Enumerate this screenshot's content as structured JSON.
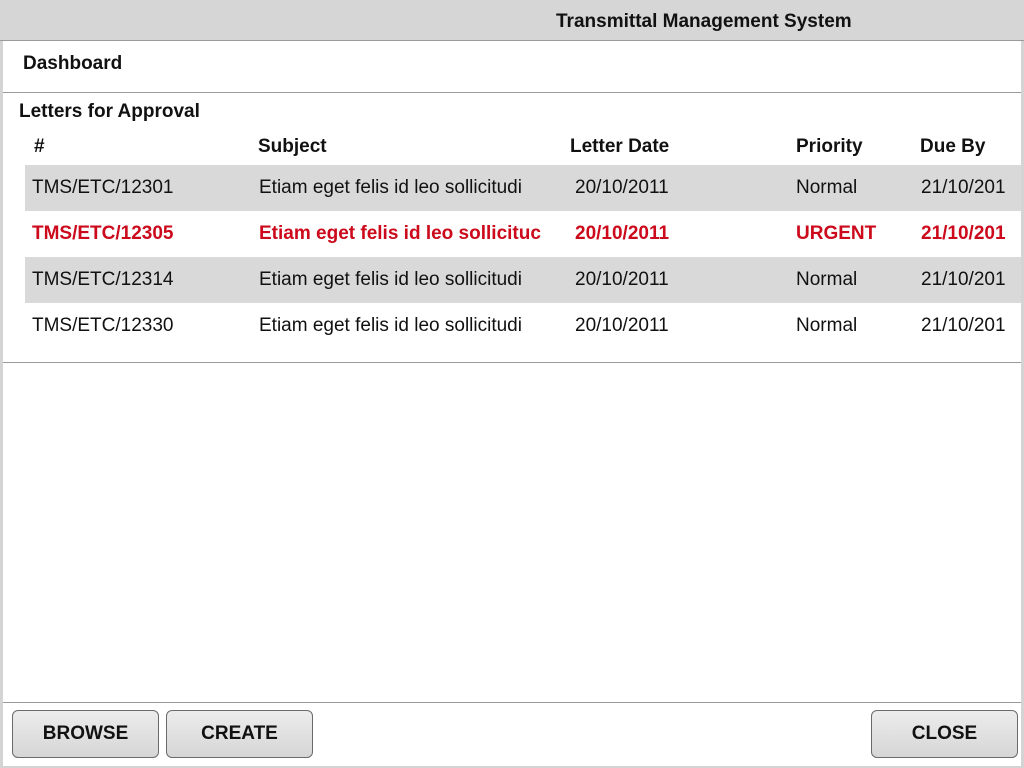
{
  "app": {
    "title": "Transmittal Management System"
  },
  "dashboard": {
    "title": "Dashboard"
  },
  "section": {
    "title": "Letters for Approval"
  },
  "table": {
    "columns": [
      "#",
      "Subject",
      "Letter Date",
      "Priority",
      "Due By"
    ],
    "rows": [
      {
        "number": "TMS/ETC/12301",
        "subject": "Etiam eget felis id leo sollicitudi",
        "letter_date": "20/10/2011",
        "priority": "Normal",
        "due_by": "21/10/201",
        "urgent": false
      },
      {
        "number": "TMS/ETC/12305",
        "subject": "Etiam eget felis id leo sollicituc",
        "letter_date": "20/10/2011",
        "priority": "URGENT",
        "due_by": "21/10/201",
        "urgent": true
      },
      {
        "number": "TMS/ETC/12314",
        "subject": "Etiam eget felis id leo sollicitudi",
        "letter_date": "20/10/2011",
        "priority": "Normal",
        "due_by": "21/10/201",
        "urgent": false
      },
      {
        "number": "TMS/ETC/12330",
        "subject": "Etiam eget felis id leo sollicitudi",
        "letter_date": "20/10/2011",
        "priority": "Normal",
        "due_by": "21/10/201",
        "urgent": false
      }
    ]
  },
  "footer": {
    "browse_label": "BROWSE",
    "create_label": "CREATE",
    "close_label": "CLOSE"
  },
  "colors": {
    "urgent": "#cc0a1c",
    "row_shade": "#d9d9d9",
    "chrome": "#d4d4d4"
  }
}
